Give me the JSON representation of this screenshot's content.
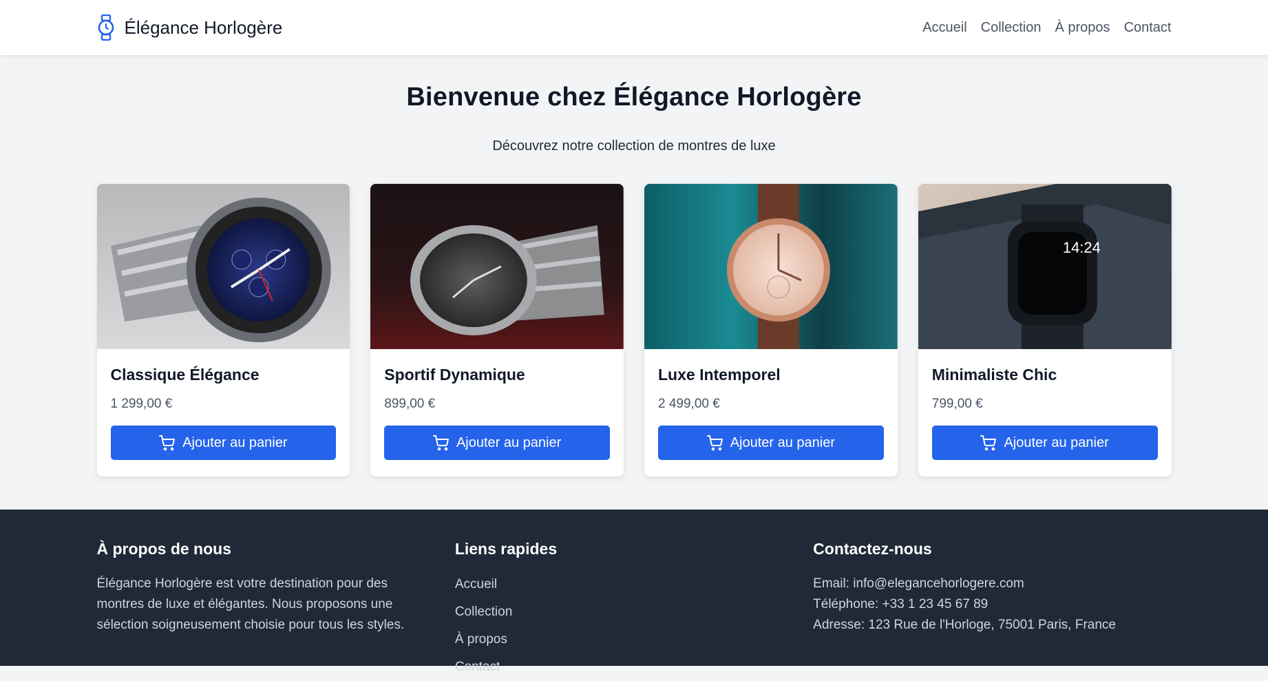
{
  "brand": {
    "name": "Élégance Horlogère",
    "icon": "watch-icon",
    "accent": "#2563eb"
  },
  "nav": [
    "Accueil",
    "Collection",
    "À propos",
    "Contact"
  ],
  "hero": {
    "title": "Bienvenue chez Élégance Horlogère",
    "subtitle": "Découvrez notre collection de montres de luxe"
  },
  "products": [
    {
      "name": "Classique Élégance",
      "price": "1 299,00 €",
      "button": "Ajouter au panier"
    },
    {
      "name": "Sportif Dynamique",
      "price": "899,00 €",
      "button": "Ajouter au panier"
    },
    {
      "name": "Luxe Intemporel",
      "price": "2 499,00 €",
      "button": "Ajouter au panier"
    },
    {
      "name": "Minimaliste Chic",
      "price": "799,00 €",
      "button": "Ajouter au panier"
    }
  ],
  "footer": {
    "about": {
      "title": "À propos de nous",
      "text": "Élégance Horlogère est votre destination pour des montres de luxe et élégantes. Nous proposons une sélection soigneusement choisie pour tous les styles."
    },
    "links": {
      "title": "Liens rapides",
      "items": [
        "Accueil",
        "Collection",
        "À propos",
        "Contact"
      ]
    },
    "contact": {
      "title": "Contactez-nous",
      "email": "Email: info@elegancehorlogere.com",
      "phone": "Téléphone: +33 1 23 45 67 89",
      "address": "Adresse: 123 Rue de l'Horloge, 75001 Paris, France"
    }
  },
  "colors": {
    "header_bg": "#ffffff",
    "page_bg": "#f3f4f6",
    "footer_bg": "#1f2937",
    "button": "#2563eb"
  }
}
